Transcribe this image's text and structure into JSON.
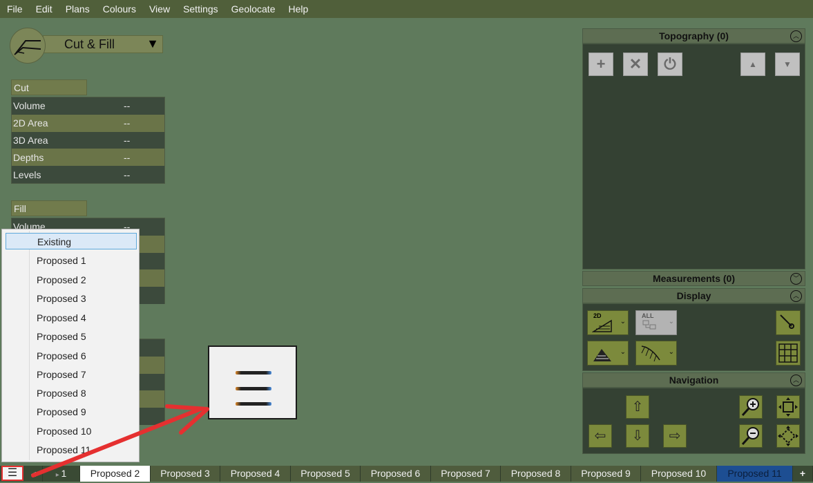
{
  "menu": [
    "File",
    "Edit",
    "Plans",
    "Colours",
    "View",
    "Settings",
    "Geolocate",
    "Help"
  ],
  "tool": {
    "selected": "Cut & Fill",
    "icon": "cut-fill-icon"
  },
  "cut": {
    "header": "Cut",
    "rows": [
      {
        "label": "Volume",
        "value": "--"
      },
      {
        "label": "2D Area",
        "value": "--"
      },
      {
        "label": "3D Area",
        "value": "--"
      },
      {
        "label": "Depths",
        "value": "--"
      },
      {
        "label": "Levels",
        "value": "--"
      }
    ]
  },
  "fill": {
    "header": "Fill",
    "first_row": {
      "label": "Volume",
      "value": "--"
    }
  },
  "plan_list": {
    "options": [
      "Existing",
      "Proposed 1",
      "Proposed 2",
      "Proposed 3",
      "Proposed 4",
      "Proposed 5",
      "Proposed 6",
      "Proposed 7",
      "Proposed 8",
      "Proposed 9",
      "Proposed 10",
      "Proposed 11"
    ],
    "selected": "Existing"
  },
  "panels": {
    "topography": "Topography (0)",
    "measurements": "Measurements (0)",
    "display": "Display",
    "navigation": "Navigation"
  },
  "display_labels": {
    "two_d": "2D",
    "all": "ALL"
  },
  "tabs": {
    "menu_icon": "☰",
    "items": [
      "1",
      "Proposed 2",
      "Proposed 3",
      "Proposed 4",
      "Proposed 5",
      "Proposed 6",
      "Proposed 7",
      "Proposed 8",
      "Proposed 9",
      "Proposed 10",
      "Proposed 11"
    ],
    "add": "+",
    "active": "Proposed 2",
    "highlight": "Proposed 11"
  },
  "colors": {
    "background": "#5f7a5c",
    "menubar": "#505f3a",
    "panel_dark": "#344133",
    "annotation": "#e53030",
    "selected_tab": "#1d4e92"
  }
}
